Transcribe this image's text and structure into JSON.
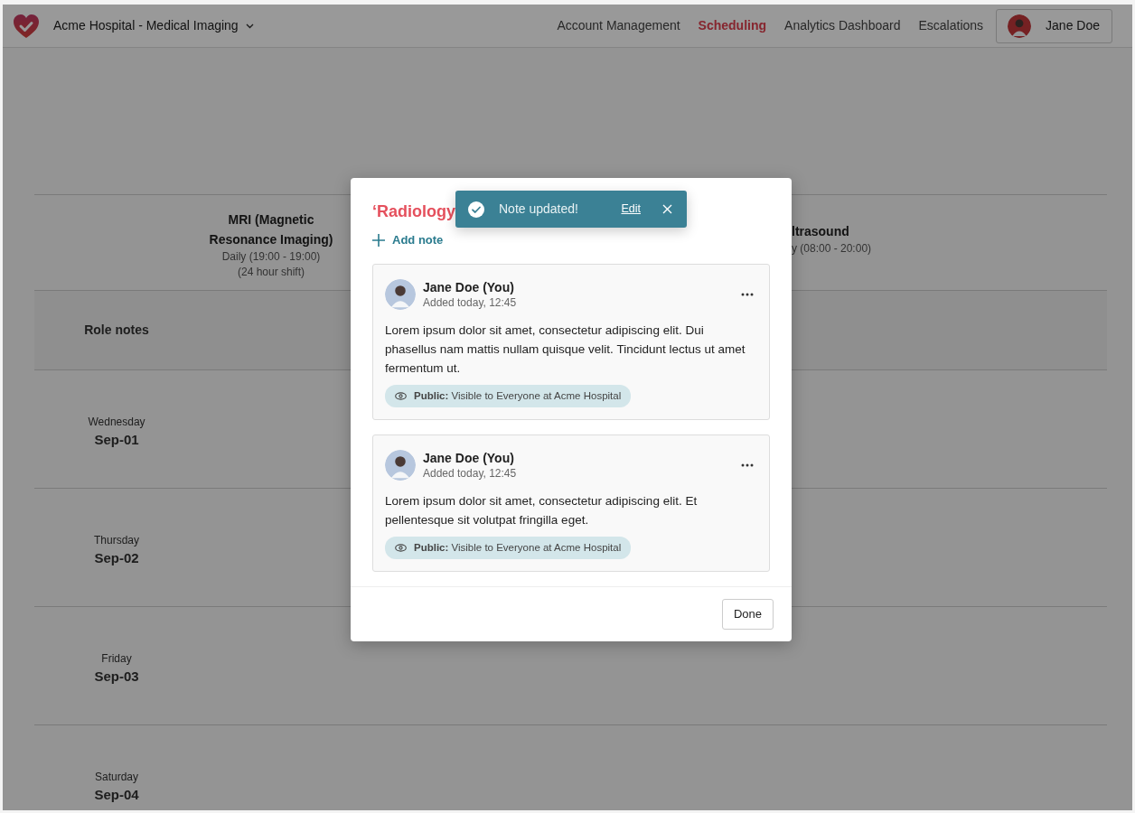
{
  "navbar": {
    "brand": "Acme Hospital - Medical Imaging",
    "links": [
      {
        "label": "Account Management",
        "selected": false
      },
      {
        "label": "Scheduling",
        "selected": true
      },
      {
        "label": "Analytics Dashboard",
        "selected": false
      },
      {
        "label": "Escalations",
        "selected": false
      }
    ],
    "user": {
      "name": "Jane Doe"
    }
  },
  "schedule": {
    "columns": [
      {
        "title": "MRI (Magnetic Resonance Imaging)",
        "lines": [
          "Daily (19:00 - 19:00)",
          "(24 hour shift)"
        ]
      },
      {
        "title": "ltrasound",
        "lines": [
          "y (08:00 - 20:00)"
        ]
      }
    ],
    "role_notes_label": "Role notes",
    "days": [
      {
        "weekday": "Wednesday",
        "date": "Sep-01"
      },
      {
        "weekday": "Thursday",
        "date": "Sep-02"
      },
      {
        "weekday": "Friday",
        "date": "Sep-03"
      },
      {
        "weekday": "Saturday",
        "date": "Sep-04"
      }
    ]
  },
  "modal": {
    "title": "‘Radiology",
    "add_note": "Add note",
    "notes": [
      {
        "author": "Jane Doe (You)",
        "time": "Added today, 12:45",
        "text": "Lorem ipsum dolor sit amet, consectetur adipiscing elit. Dui phasellus nam mattis nullam quisque velit. Tincidunt lectus ut amet fermentum ut.",
        "visibility": "**Public:** Visible to Everyone at Acme Hospital"
      },
      {
        "author": "Jane Doe (You)",
        "time": "Added today, 12:45",
        "text": "Lorem ipsum dolor sit amet, consectetur adipiscing elit. Et pellentesque sit volutpat fringilla eget.",
        "visibility": "**Public:** Visible to Everyone at Acme Hospital"
      }
    ],
    "done": "Done"
  },
  "toast": {
    "message": "Note updated!",
    "action": "Edit"
  }
}
